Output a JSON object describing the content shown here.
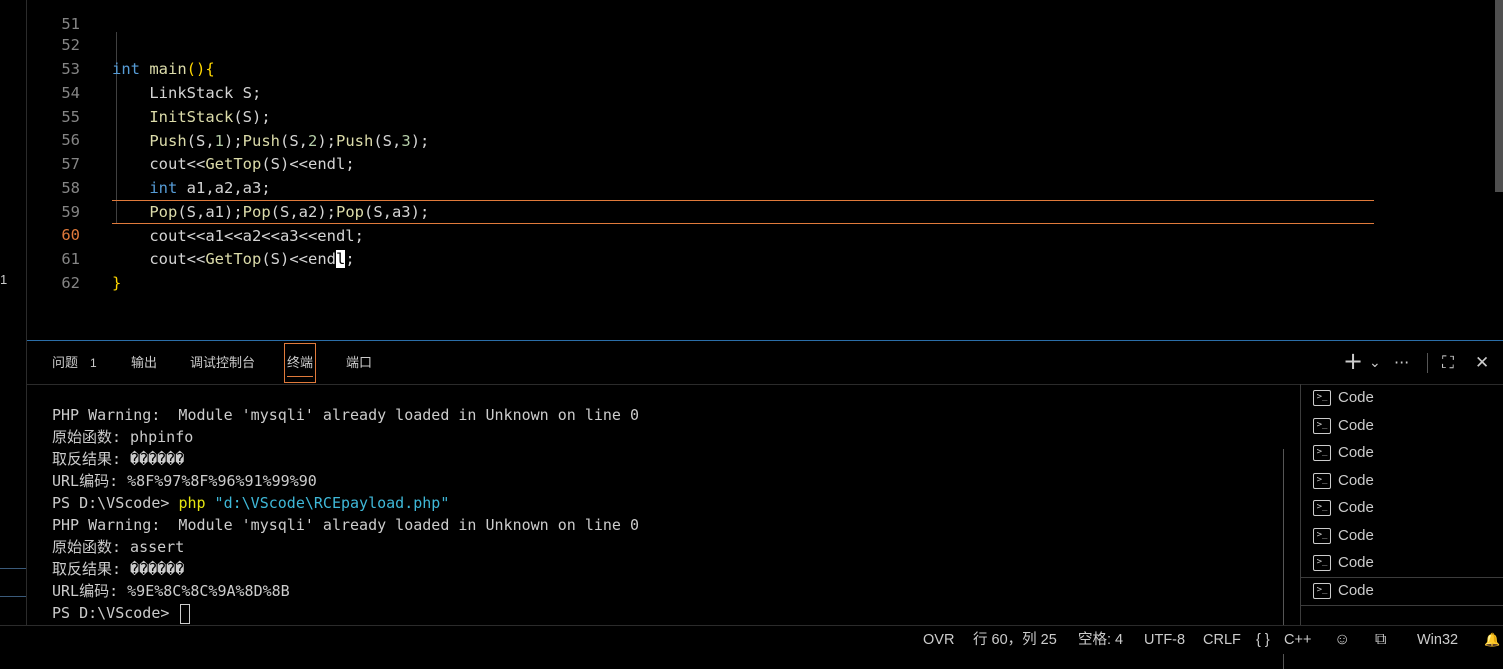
{
  "left_strip": {
    "badge": "1"
  },
  "editor": {
    "lines": [
      {
        "num": "51"
      },
      {
        "num": "52"
      },
      {
        "num": "53"
      },
      {
        "num": "54"
      },
      {
        "num": "55"
      },
      {
        "num": "56"
      },
      {
        "num": "57"
      },
      {
        "num": "58"
      },
      {
        "num": "59"
      },
      {
        "num": "60"
      },
      {
        "num": "61"
      },
      {
        "num": "62"
      }
    ],
    "code": {
      "l52_kw": "int",
      "l52_fn": " main",
      "l52_paren": "()",
      "l52_brace": "{",
      "l53": "    LinkStack S;",
      "l54_fn": "    InitStack",
      "l54_rest": "(S);",
      "l55_a": "Push",
      "l55_b": "(S,",
      "l55_c": "1",
      "l55_d": ");",
      "l55_e": "Push",
      "l55_f": "(S,",
      "l55_g": "2",
      "l55_h": ");",
      "l55_i": "Push",
      "l55_j": "(S,",
      "l55_k": "3",
      "l55_l": ");",
      "l56_a": "cout<<",
      "l56_b": "GetTop",
      "l56_c": "(S)<<",
      "l56_d": "endl;",
      "l57_kw": "int",
      "l57_rest": " a1,a2,a3;",
      "l58_a": "Pop",
      "l58_b": "(S,a1);",
      "l58_c": "Pop",
      "l58_d": "(S,a2);",
      "l58_e": "Pop",
      "l58_f": "(S,a3);",
      "l59": "cout<<a1<<a2<<a3<<endl;",
      "l60_a": "cout<<",
      "l60_b": "GetTop",
      "l60_c": "(S)<<end",
      "l60_cursor": "l",
      "l60_d": ";",
      "l61_brace": "}"
    }
  },
  "panel": {
    "tabs": [
      {
        "label": "问题",
        "count": "1"
      },
      {
        "label": "输出"
      },
      {
        "label": "调试控制台"
      },
      {
        "label": "终端"
      },
      {
        "label": "端口"
      }
    ],
    "actions": {
      "add": "+",
      "dropdown": "⌄",
      "more": "···",
      "maximize": "⛶",
      "close": "✕"
    }
  },
  "terminal": {
    "lines": [
      "PHP Warning:  Module 'mysqli' already loaded in Unknown on line 0",
      "原始函数: phpinfo",
      "取反结果: ������",
      "URL编码: %8F%97%8F%96%91%99%90",
      "PS D:\\VScode> ",
      "PHP Warning:  Module 'mysqli' already loaded in Unknown on line 0",
      "原始函数: assert",
      "取反结果: ������",
      "URL编码: %9E%8C%8C%9A%8D%8B",
      "PS D:\\VScode> "
    ],
    "cmd": "php",
    "cmd_arg": " \"d:\\VScode\\RCEpayload.php\""
  },
  "terminal_list": {
    "items": [
      "Code",
      "Code",
      "Code",
      "Code",
      "Code",
      "Code",
      "Code",
      "Code"
    ]
  },
  "statusbar": {
    "ovr": "OVR",
    "position": "行 60，列 25",
    "spaces": "空格: 4",
    "encoding": "UTF-8",
    "eol": "CRLF",
    "lang_braces": "{ }",
    "language": "C++",
    "copilot": "☺",
    "remote": "⧉",
    "platform": "Win32",
    "bell": "🔔"
  }
}
